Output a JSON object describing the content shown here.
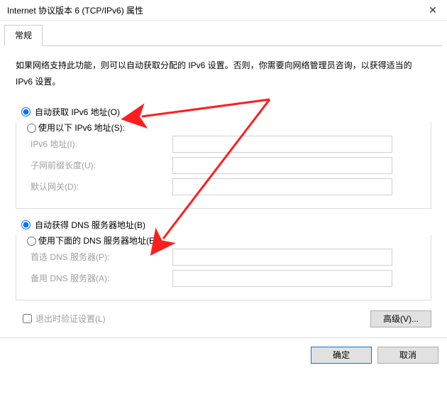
{
  "window": {
    "title": "Internet 协议版本 6 (TCP/IPv6) 属性"
  },
  "tabs": {
    "general": "常规"
  },
  "description": "如果网络支持此功能，则可以自动获取分配的 IPv6 设置。否则，你需要向网络管理员咨询，以获得适当的 IPv6 设置。",
  "ip": {
    "auto_label": "自动获取 IPv6 地址(O)",
    "manual_label": "使用以下 IPv6 地址(S):",
    "addr_label": "IPv6 地址(I):",
    "addr_value": "",
    "prefix_label": "子网前缀长度(U):",
    "prefix_value": "",
    "gateway_label": "默认网关(D):",
    "gateway_value": ""
  },
  "dns": {
    "auto_label": "自动获得 DNS 服务器地址(B)",
    "manual_label": "使用下面的 DNS 服务器地址(E):",
    "pref_label": "首选 DNS 服务器(P):",
    "pref_value": "",
    "alt_label": "备用 DNS 服务器(A):",
    "alt_value": ""
  },
  "validate_label": "退出时验证设置(L)",
  "advanced_label": "高级(V)...",
  "ok_label": "确定",
  "cancel_label": "取消"
}
